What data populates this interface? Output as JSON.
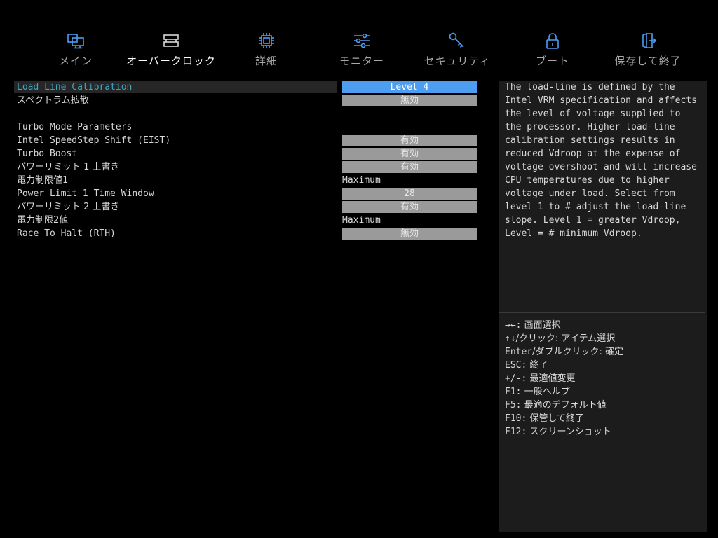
{
  "nav": {
    "tabs": [
      {
        "label": "メイン",
        "icon": "computer-icon",
        "active": false
      },
      {
        "label": "オーバークロック",
        "icon": "memory-icon",
        "active": true
      },
      {
        "label": "詳細",
        "icon": "cpu-chip-icon",
        "active": false
      },
      {
        "label": "モニター",
        "icon": "sliders-icon",
        "active": false
      },
      {
        "label": "セキュリティ",
        "icon": "key-icon",
        "active": false
      },
      {
        "label": "ブート",
        "icon": "lock-icon",
        "active": false
      },
      {
        "label": "保存して終了",
        "icon": "exit-door-icon",
        "active": false
      }
    ],
    "icon_color": "#4d9ef0"
  },
  "settings": [
    {
      "name": "Load Line Calibration",
      "value": "Level 4",
      "selected": true
    },
    {
      "name": "スペクトラム拡散",
      "value": "無効"
    },
    {
      "name": "Turbo Mode Parameters"
    },
    {
      "name": "Intel SpeedStep Shift (EIST)",
      "value": "有効"
    },
    {
      "name": "Turbo Boost",
      "value": "有効"
    },
    {
      "name": "パワーリミット 1 上書き",
      "value": "有効"
    },
    {
      "name": "電力制限値1",
      "value": "Maximum",
      "plain": true
    },
    {
      "name": "Power Limit 1 Time Window",
      "value": "28"
    },
    {
      "name": "パワーリミット 2 上書き",
      "value": "有効"
    },
    {
      "name": "電力制限2値",
      "value": "Maximum",
      "plain": true
    },
    {
      "name": "Race To Halt (RTH)",
      "value": "無効"
    }
  ],
  "help": {
    "description": "The load-line is defined by the\nIntel VRM specification and affects\nthe level of voltage supplied to\nthe processor. Higher load-line\ncalibration settings results in\nreduced Vdroop at the expense of\nvoltage overshoot and will increase\nCPU temperatures due to higher\nvoltage under load. Select from\nlevel 1 to # adjust the load-line\nslope. Level 1 = greater Vdroop,\nLevel = # minimum Vdroop.",
    "keys": [
      {
        "key": "→←:",
        "desc": " 画面選択"
      },
      {
        "key": "↑↓",
        "desc": "/クリック: アイテム選択"
      },
      {
        "key": "Enter",
        "desc": "/ダブルクリック: 確定"
      },
      {
        "key": "ESC:",
        "desc": " 終了"
      },
      {
        "key": "+/-:",
        "desc": " 最適値変更"
      },
      {
        "key": "F1:",
        "desc": " 一般ヘルプ"
      },
      {
        "key": "F5:",
        "desc": " 最適のデフォルト値"
      },
      {
        "key": "F10:",
        "desc": " 保管して終了"
      },
      {
        "key": "F12:",
        "desc": " スクリーンショット"
      }
    ]
  },
  "colors": {
    "selected_value_bg": "#4d9ef0",
    "selected_name_text": "#3da7c4",
    "value_bg": "#9a9a9a",
    "help_bg": "#1c1c1c"
  }
}
